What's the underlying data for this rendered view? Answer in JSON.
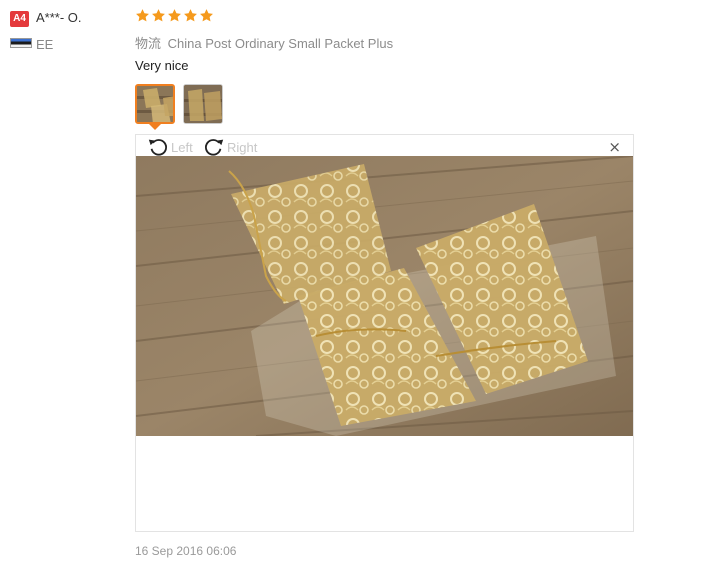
{
  "user": {
    "badge": "A4",
    "name": "A***- O.",
    "country": "EE"
  },
  "review": {
    "rating": 5,
    "rating_max": 5,
    "logistics_label": "物流",
    "logistics_value": "China Post Ordinary Small Packet Plus",
    "text": "Very nice",
    "date": "16 Sep 2016 06:06"
  },
  "viewer": {
    "rotate_left_label": "Left",
    "rotate_right_label": "Right",
    "close_label": "×"
  },
  "icons": {
    "star": "star-icon",
    "rotate_left": "rotate-left-icon",
    "rotate_right": "rotate-right-icon",
    "close": "close-icon"
  },
  "colors": {
    "star": "#f59a1d",
    "badge": "#e4393c",
    "thumb_active": "#f07f20"
  }
}
